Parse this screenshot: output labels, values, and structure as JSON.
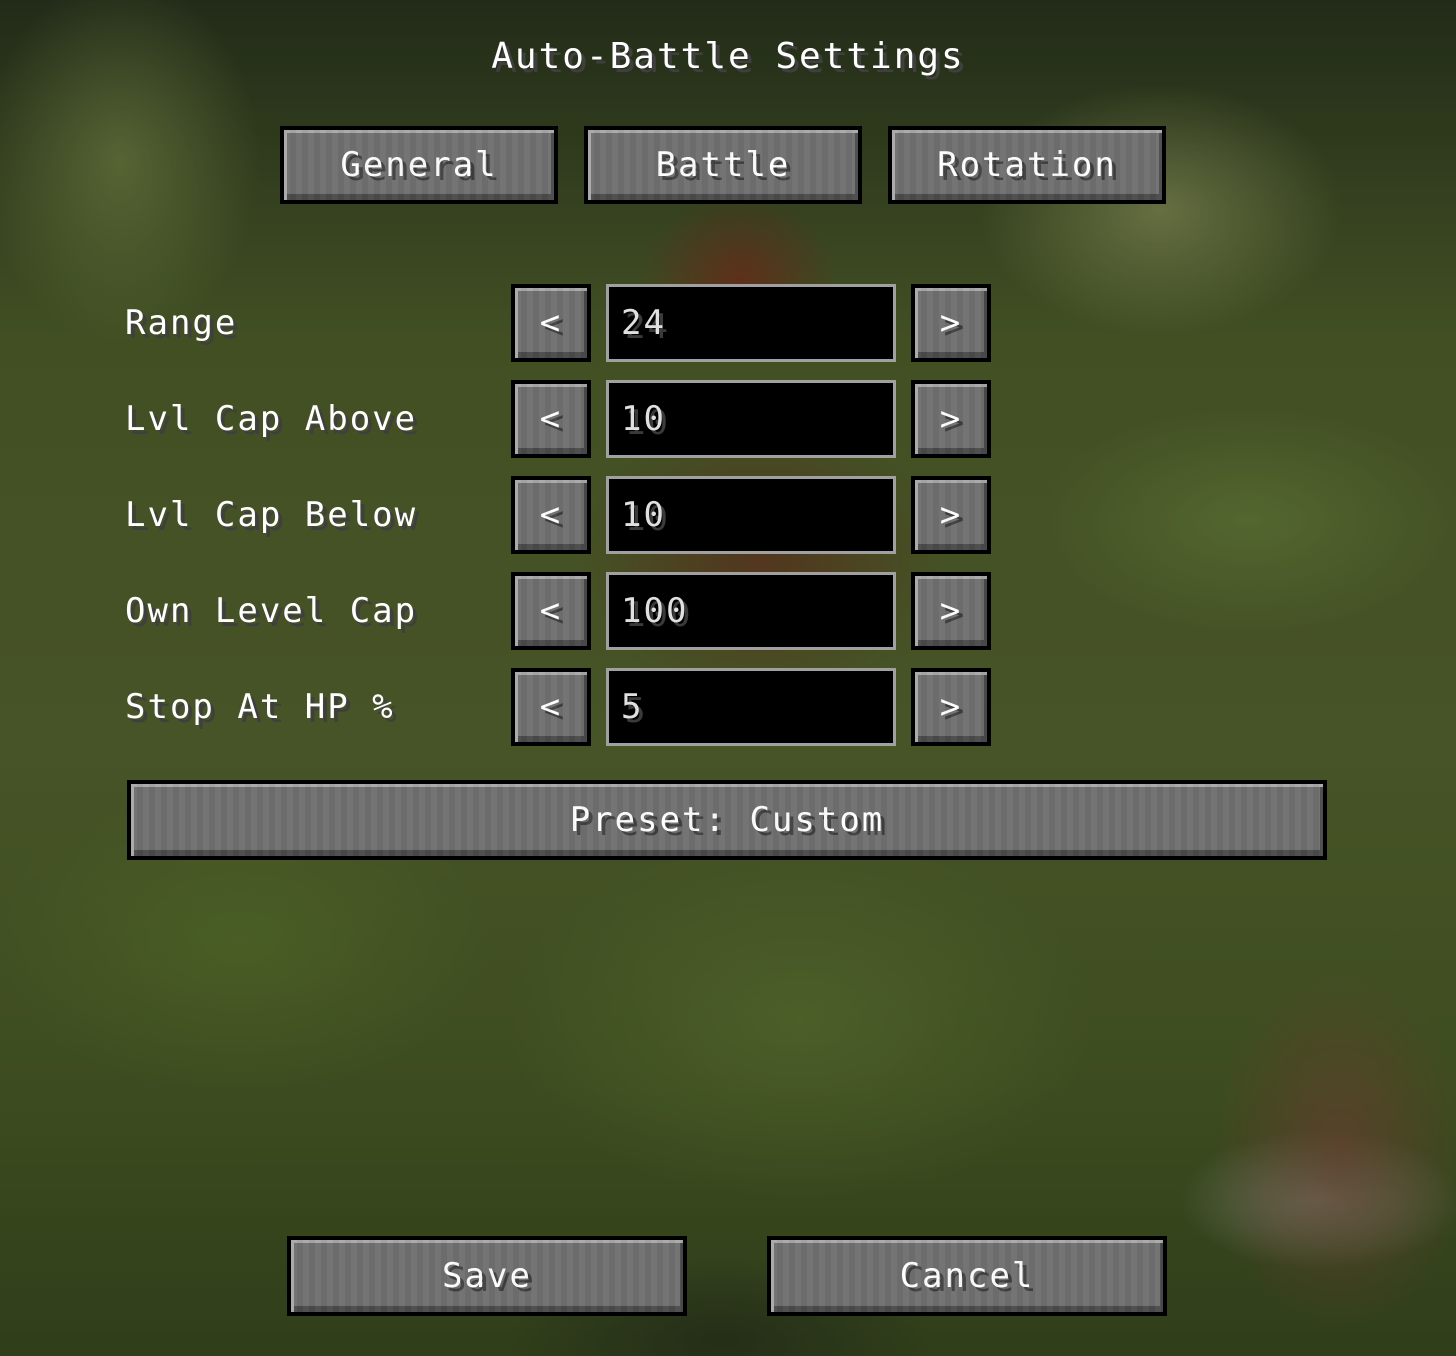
{
  "title": "Auto-Battle Settings",
  "tabs": [
    {
      "label": "General"
    },
    {
      "label": "Battle"
    },
    {
      "label": "Rotation"
    }
  ],
  "settings": [
    {
      "label": "Range",
      "value": "24"
    },
    {
      "label": "Lvl Cap Above",
      "value": "10"
    },
    {
      "label": "Lvl Cap Below",
      "value": "10"
    },
    {
      "label": "Own Level Cap",
      "value": "100"
    },
    {
      "label": "Stop At HP %",
      "value": "5"
    }
  ],
  "arrows": {
    "decrease": "<",
    "increase": ">"
  },
  "preset": {
    "label": "Preset: Custom"
  },
  "footer": {
    "save_label": "Save",
    "cancel_label": "Cancel"
  }
}
